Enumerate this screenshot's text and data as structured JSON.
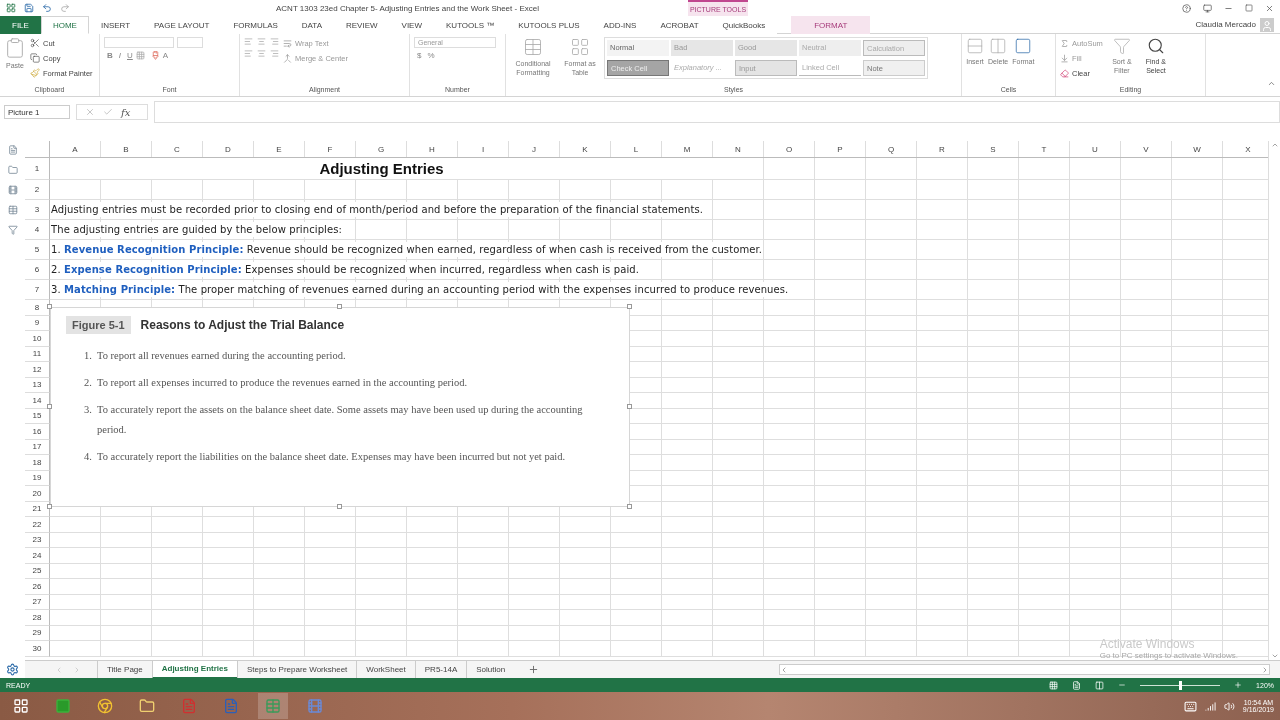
{
  "title_bar": {
    "title": "ACNT 1303 23ed Chapter 5- Adjusting Entries and the Work Sheet - Excel",
    "context_label": "PICTURE TOOLS",
    "user": "Claudia Mercado"
  },
  "ribbon_tabs": [
    {
      "label": "FILE",
      "kind": "file",
      "selected": false
    },
    {
      "label": "HOME",
      "kind": "plain",
      "selected": true
    },
    {
      "label": "INSERT",
      "kind": "plain",
      "selected": false
    },
    {
      "label": "PAGE LAYOUT",
      "kind": "plain",
      "selected": false
    },
    {
      "label": "FORMULAS",
      "kind": "plain",
      "selected": false
    },
    {
      "label": "DATA",
      "kind": "plain",
      "selected": false
    },
    {
      "label": "REVIEW",
      "kind": "plain",
      "selected": false
    },
    {
      "label": "VIEW",
      "kind": "plain",
      "selected": false
    },
    {
      "label": "KUTOOLS ™",
      "kind": "plain",
      "selected": false
    },
    {
      "label": "KUTOOLS PLUS",
      "kind": "plain",
      "selected": false
    },
    {
      "label": "ADD-INS",
      "kind": "plain",
      "selected": false
    },
    {
      "label": "ACROBAT",
      "kind": "plain",
      "selected": false
    },
    {
      "label": "QuickBooks",
      "kind": "plain",
      "selected": false
    },
    {
      "label": "FORMAT",
      "kind": "context",
      "selected": false
    }
  ],
  "ribbon_groups": [
    {
      "kind": "clipboard",
      "label": "Clipboard",
      "paste": "Paste",
      "cut": "Cut",
      "copy": "Copy",
      "format_painter": "Format Painter"
    },
    {
      "kind": "font",
      "label": "Font",
      "bold": "B",
      "italic": "I",
      "underline": "U",
      "font_color": "A"
    },
    {
      "kind": "alignment",
      "label": "Alignment",
      "wrap": "Wrap Text",
      "merge": "Merge & Center"
    },
    {
      "kind": "number",
      "label": "Number",
      "format": "General",
      "currency": "$",
      "percent": "%"
    },
    {
      "kind": "styles",
      "label": "Styles",
      "conditional": "Conditional Formatting",
      "format_table": "Format as Table",
      "cells": [
        {
          "label": "Normal",
          "kind": "normal"
        },
        {
          "label": "Bad",
          "kind": "bad"
        },
        {
          "label": "Good",
          "kind": "good"
        },
        {
          "label": "Neutral",
          "kind": "neutral"
        },
        {
          "label": "Calculation",
          "kind": "calculation"
        },
        {
          "label": "Check Cell",
          "kind": "check"
        },
        {
          "label": "Explanatory ...",
          "kind": "explanatory"
        },
        {
          "label": "Input",
          "kind": "input"
        },
        {
          "label": "Linked Cell",
          "kind": "linked"
        },
        {
          "label": "Note",
          "kind": "note"
        }
      ]
    },
    {
      "kind": "cells",
      "label": "Cells",
      "buttons": [
        "Insert",
        "Delete",
        "Format"
      ]
    },
    {
      "kind": "editing",
      "label": "Editing",
      "autosum": "AutoSum",
      "fill": "Fill",
      "clear": "Clear",
      "sort": "Sort & Filter",
      "find": "Find & Select"
    }
  ],
  "formula_bar": {
    "name_box": "Picture 1",
    "fx": "fx"
  },
  "columns": [
    "A",
    "B",
    "C",
    "D",
    "E",
    "F",
    "G",
    "H",
    "I",
    "J",
    "K",
    "L",
    "M",
    "N",
    "O",
    "P",
    "Q",
    "R",
    "S",
    "T",
    "U",
    "V",
    "W",
    "X"
  ],
  "rows": [
    {
      "number": "1",
      "kind": "title",
      "text": "Adjusting Entries"
    },
    {
      "number": "2"
    },
    {
      "number": "3",
      "kind": "text",
      "text": "Adjusting entries must be recorded prior to closing end of month/period and before the preparation of the financial statements."
    },
    {
      "number": "4",
      "kind": "text",
      "text": "The adjusting entries are guided by the below principles:"
    },
    {
      "number": "5",
      "kind": "principle",
      "num": "1.",
      "term": "Revenue Recognition Principle:",
      "text": "Revenue should be recognized when earned, regardless of when cash is received from the customer."
    },
    {
      "number": "6",
      "kind": "principle",
      "num": "2.",
      "term": "Expense Recognition Principle:",
      "text": "Expenses should be recognized when incurred, regardless when cash is paid."
    },
    {
      "number": "7",
      "kind": "principle",
      "num": "3.",
      "term": "Matching Principle:",
      "text": "The proper matching of revenues earned during an accounting period with the expenses incurred to produce revenues."
    },
    {
      "number": "8"
    },
    {
      "number": "9"
    },
    {
      "number": "10"
    },
    {
      "number": "11"
    },
    {
      "number": "12"
    },
    {
      "number": "13"
    },
    {
      "number": "14"
    },
    {
      "number": "15"
    },
    {
      "number": "16"
    },
    {
      "number": "17"
    },
    {
      "number": "18"
    },
    {
      "number": "19"
    },
    {
      "number": "20"
    },
    {
      "number": "21"
    },
    {
      "number": "22"
    },
    {
      "number": "23"
    },
    {
      "number": "24"
    },
    {
      "number": "25"
    },
    {
      "number": "26"
    },
    {
      "number": "27"
    },
    {
      "number": "28"
    },
    {
      "number": "29"
    },
    {
      "number": "30"
    }
  ],
  "figure": {
    "label": "Figure 5-1",
    "title": "Reasons to Adjust the Trial Balance",
    "items": [
      {
        "num": "1.",
        "text": "To report all revenues earned during the accounting period."
      },
      {
        "num": "2.",
        "text": "To report all expenses incurred to produce the revenues earned in the accounting period."
      },
      {
        "num": "3.",
        "text": "To accurately report the assets on the balance sheet date. Some assets may have been used up during the accounting period."
      },
      {
        "num": "4.",
        "text": "To accurately report the liabilities on the balance sheet date. Expenses may have been incurred but not yet paid."
      }
    ]
  },
  "sheet_tabs": [
    {
      "label": "Title Page",
      "selected": false
    },
    {
      "label": "Adjusting Entries",
      "selected": true
    },
    {
      "label": "Steps to Prepare Worksheet",
      "selected": false
    },
    {
      "label": "WorkSheet",
      "selected": false
    },
    {
      "label": "PR5-14A",
      "selected": false
    },
    {
      "label": "Solution",
      "selected": false
    }
  ],
  "watermark": {
    "title": "Activate Windows",
    "text": "Go to PC settings to activate Windows."
  },
  "status_bar": {
    "text": "READY",
    "zoom": "120%",
    "zoom_slider": {
      "level": 0.5
    }
  },
  "taskbar": {
    "time": "10:54 AM",
    "date": "9/16/2019"
  }
}
